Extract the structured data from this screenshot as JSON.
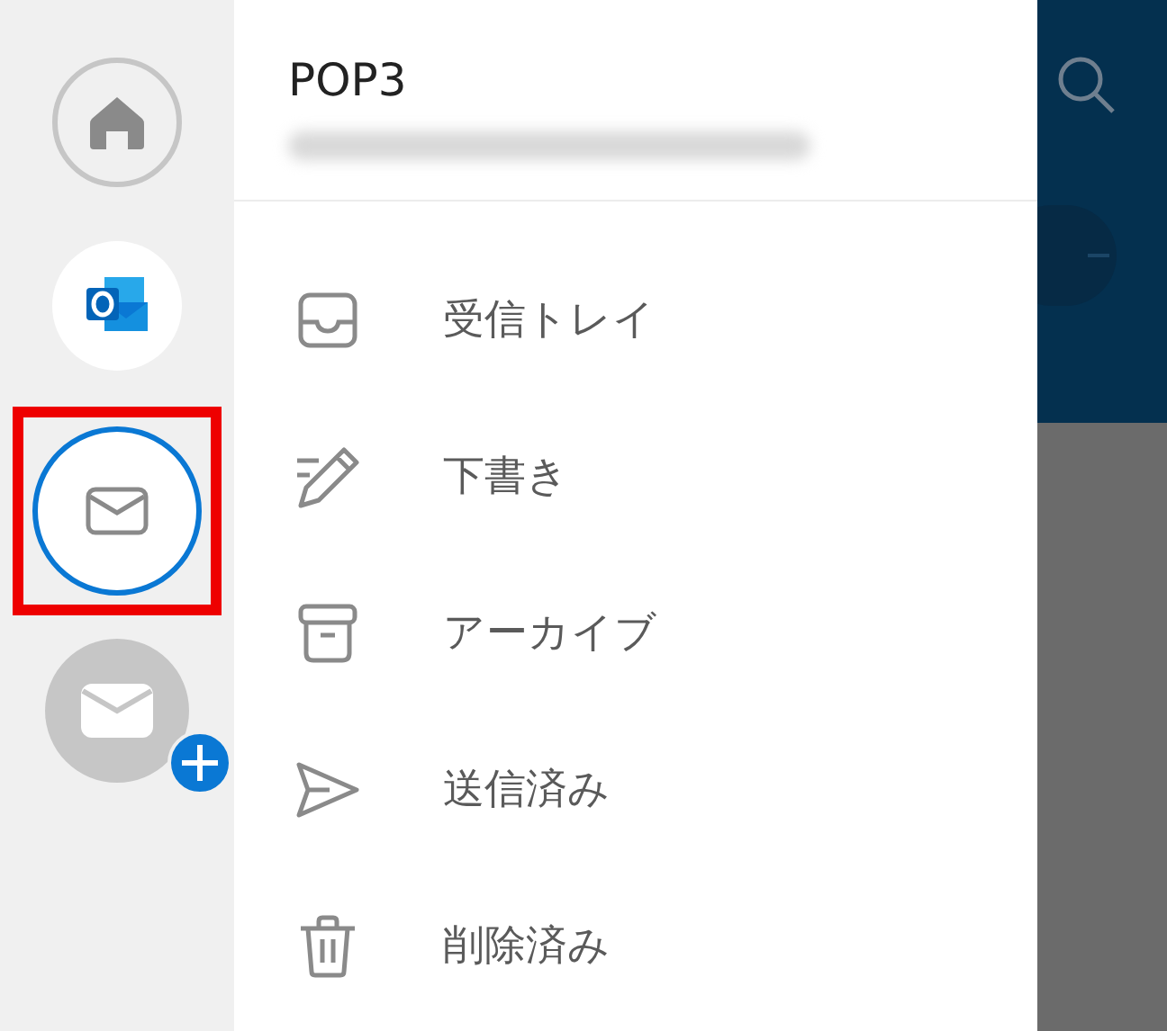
{
  "rail": {
    "accounts": [
      {
        "kind": "home",
        "selected": false,
        "highlighted": false
      },
      {
        "kind": "outlook",
        "selected": false,
        "highlighted": false
      },
      {
        "kind": "mail",
        "selected": true,
        "highlighted": true
      },
      {
        "kind": "add",
        "selected": false,
        "highlighted": false
      }
    ]
  },
  "drawer": {
    "account_name": "POP3",
    "folders": [
      {
        "kind": "inbox",
        "label": "受信トレイ"
      },
      {
        "kind": "drafts",
        "label": "下書き"
      },
      {
        "kind": "archive",
        "label": "アーカイブ"
      },
      {
        "kind": "sent",
        "label": "送信済み"
      },
      {
        "kind": "deleted",
        "label": "削除済み"
      }
    ]
  }
}
